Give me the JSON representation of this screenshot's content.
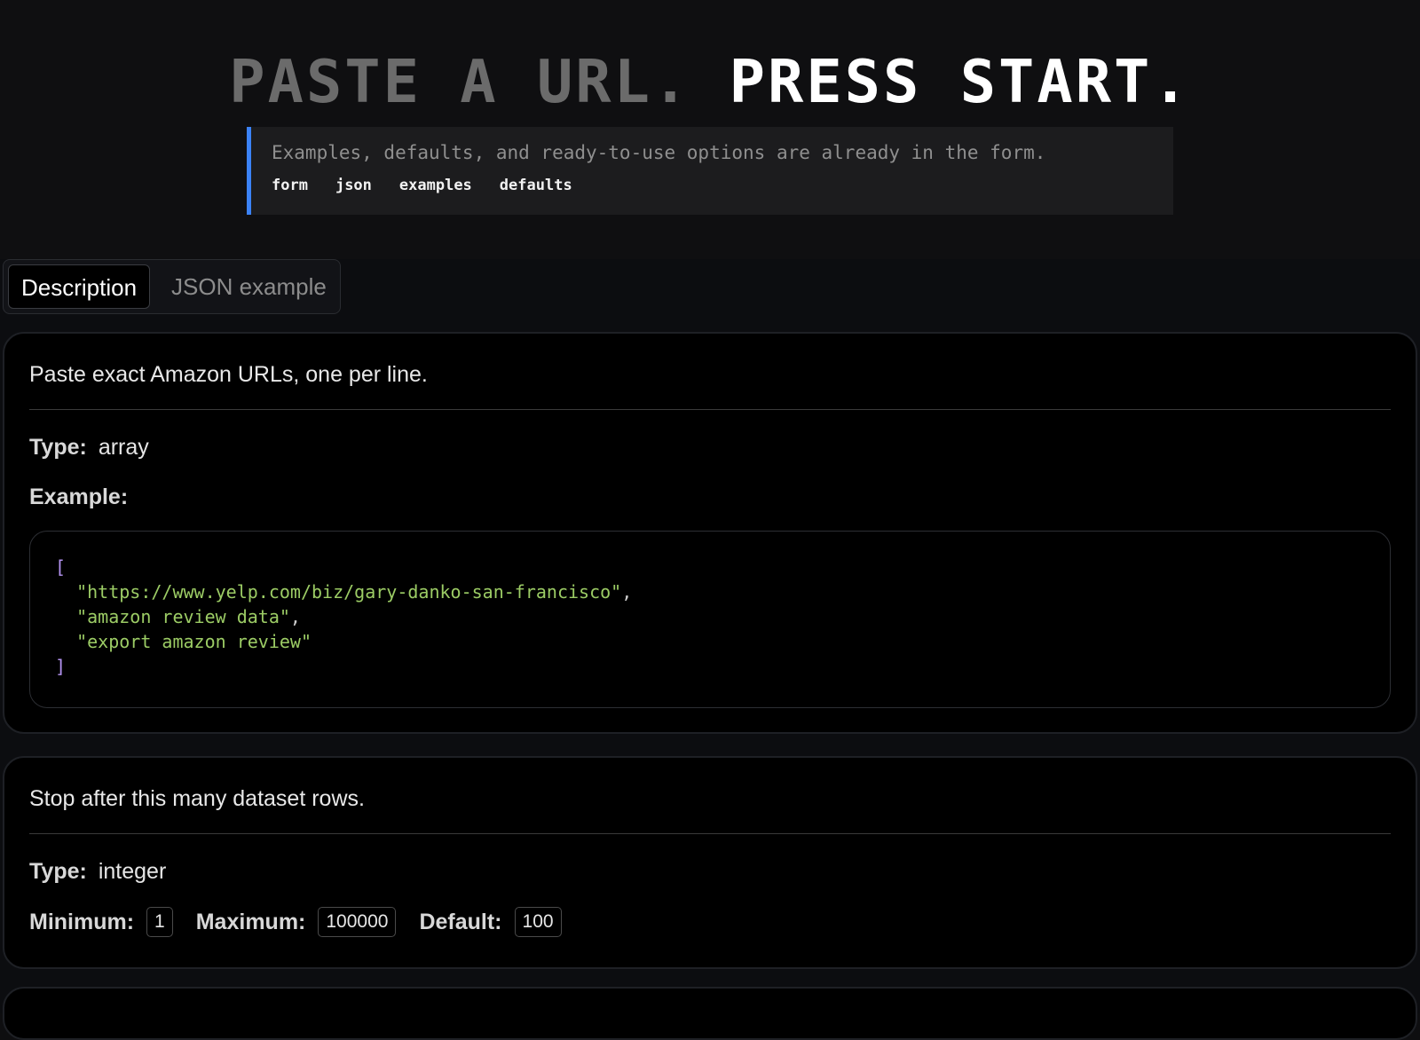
{
  "header": {
    "headline_dim": "PASTE A URL.",
    "headline_bright": "PRESS START.",
    "callout_text": "Examples, defaults, and ready-to-use options are already in the form.",
    "chips": [
      "form",
      "json",
      "examples",
      "defaults"
    ]
  },
  "tabs": {
    "description": "Description",
    "json_example": "JSON example"
  },
  "fields": [
    {
      "description": "Paste exact Amazon URLs, one per line.",
      "type_label": "Type:",
      "type_value": "array",
      "example_label": "Example:",
      "example": {
        "open": "[",
        "items": [
          "\"https://www.yelp.com/biz/gary-danko-san-francisco\"",
          "\"amazon review data\"",
          "\"export amazon review\""
        ],
        "close": "]"
      }
    },
    {
      "description": "Stop after this many dataset rows.",
      "type_label": "Type:",
      "type_value": "integer",
      "minimum_label": "Minimum:",
      "minimum": "1",
      "maximum_label": "Maximum:",
      "maximum": "100000",
      "default_label": "Default:",
      "default": "100"
    }
  ],
  "colors": {
    "accent": "#3b82f6",
    "string": "#9ccc65",
    "bracket": "#b392f0"
  }
}
